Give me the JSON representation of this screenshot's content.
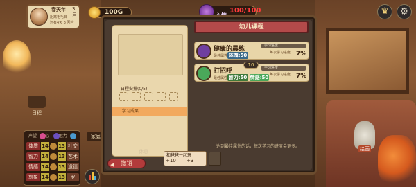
{
  "character": {
    "season": "春天年",
    "day": "3月",
    "line1": "距离毛毛日",
    "line2": "还有4天 3 回合"
  },
  "currency": {
    "coins": "100G"
  },
  "mood": {
    "label": "心情",
    "value": "100/100"
  },
  "topbar": {
    "trophy_icon": "trophy-icon",
    "settings_icon": "gear-icon"
  },
  "left_hud": {
    "schedule_label": "日程",
    "home_tab": "家庭"
  },
  "stats": {
    "header": [
      "声望",
      "心",
      "魅力"
    ],
    "rows": [
      {
        "name": "体质",
        "value": "14",
        "value2": "13",
        "name2": "社交"
      },
      {
        "name": "智力",
        "value": "14",
        "value2": "13",
        "name2": "艺术"
      },
      {
        "name": "情感",
        "value": "14",
        "value2": "13",
        "name2": "道德"
      },
      {
        "name": "想象",
        "value": "14",
        "value2": "13",
        "name2": "罗"
      }
    ]
  },
  "panel": {
    "title": "幼儿课程",
    "schedule_title": "日程安排(0/5)",
    "result_tab": "学习成果",
    "hint": "达到最佳属性的话，每次学习的进度会更多。",
    "rest_label": "休息",
    "cancel_label": "撤销"
  },
  "activities": [
    {
      "title": "健康的晨练",
      "attr_label": "最佳属性",
      "attr_badge": "体魄:50",
      "attr_badge_color": "#3a6a8a",
      "attr_badge2": "",
      "progress_label": "学习进度",
      "progress_fraction": 0.0,
      "speed_label": "每次学习进度",
      "percent": "7%",
      "level": "",
      "icon": "exercise-icon",
      "icon_color": "#6f3fa0"
    },
    {
      "title": "打招呼",
      "attr_label": "最佳属性",
      "attr_badge": "智力:50",
      "attr_badge_color": "#3f7a3a",
      "attr_badge2": "情感:50",
      "attr_badge2_color": "#4aa85a",
      "progress_label": "学习进度",
      "progress_fraction": 0.0,
      "speed_label": "每次学习进度",
      "percent": "7%",
      "level": "10",
      "icon": "greeting-icon",
      "icon_color": "#4aa85a"
    }
  ],
  "play_card": {
    "title": "和爸爸一起玩",
    "a": "+10",
    "b": "+3"
  },
  "paint": {
    "label": "绘画"
  },
  "chart_btn_icon": "bar-chart-icon"
}
